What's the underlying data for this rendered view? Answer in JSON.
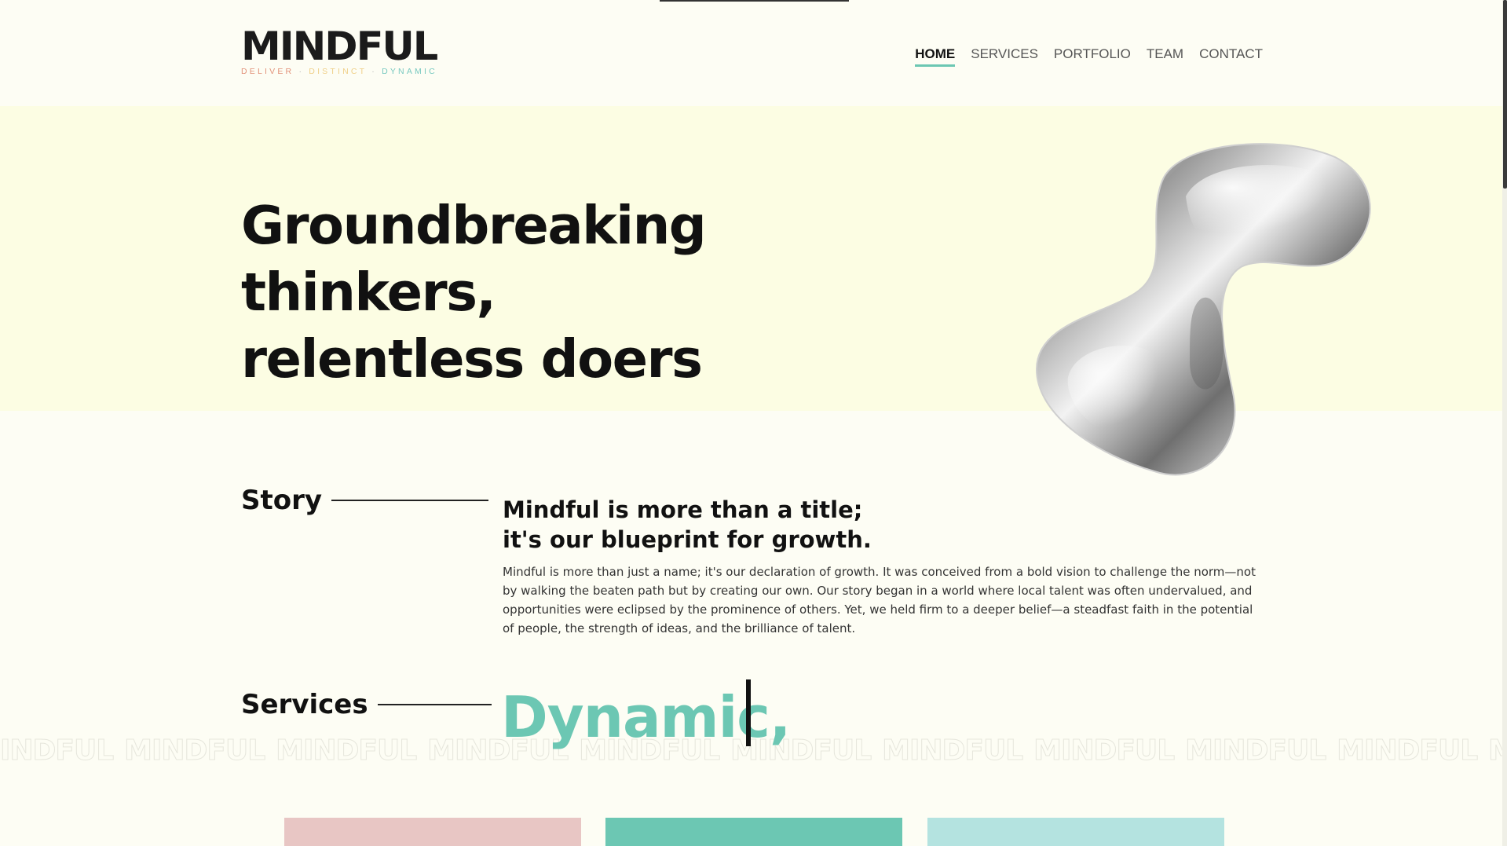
{
  "header": {
    "logo_text": "MINDFUL",
    "logo_tagline": [
      {
        "text": "DELIVER",
        "color": "#e2927a"
      },
      {
        "text": "·",
        "color": "#b8b8b8"
      },
      {
        "text": "DISTINCT",
        "color": "#efd089"
      },
      {
        "text": "·",
        "color": "#b8b8b8"
      },
      {
        "text": "DYNAMIC",
        "color": "#78c9c0"
      }
    ],
    "nav": [
      {
        "label": "HOME",
        "active": true
      },
      {
        "label": "SERVICES",
        "active": false
      },
      {
        "label": "PORTFOLIO",
        "active": false
      },
      {
        "label": "TEAM",
        "active": false
      },
      {
        "label": "CONTACT",
        "active": false
      }
    ]
  },
  "hero": {
    "title_line1": "Groundbreaking thinkers,",
    "title_line2": "relentless doers",
    "background": "#fcfde3",
    "image": "chrome-blob-sculpture"
  },
  "story": {
    "label": "Story",
    "heading_line1": "Mindful is more than a title;",
    "heading_line2": "it's our blueprint for growth.",
    "body": "Mindful is more than just a name; it's our declaration of growth. It was conceived from a bold vision to challenge the norm—not by walking the beaten path but by creating our own. Our story began in a world where local talent was often undervalued, and opportunities were eclipsed by the prominence of others. Yet, we held firm to a deeper belief—a steadfast faith in the potential of people, the strength of ideas, and the brilliance of talent."
  },
  "services": {
    "label": "Services",
    "typed_word": "Dynamic,",
    "accent": "#6cc7b3"
  },
  "marquee": {
    "word": "MINDFUL",
    "repeat": [
      "INDFUL",
      "MINDFUL",
      "MINDFUL",
      "MINDFUL",
      "MINDFUL",
      "MINDFUL",
      "MINDFUL",
      "MINDFUL",
      "MINDFUL",
      "MINDFUL",
      "MIN"
    ]
  },
  "cards": [
    {
      "color": "#e8c6c4"
    },
    {
      "color": "#6cc7b3"
    },
    {
      "color": "#b4e3e0"
    }
  ]
}
